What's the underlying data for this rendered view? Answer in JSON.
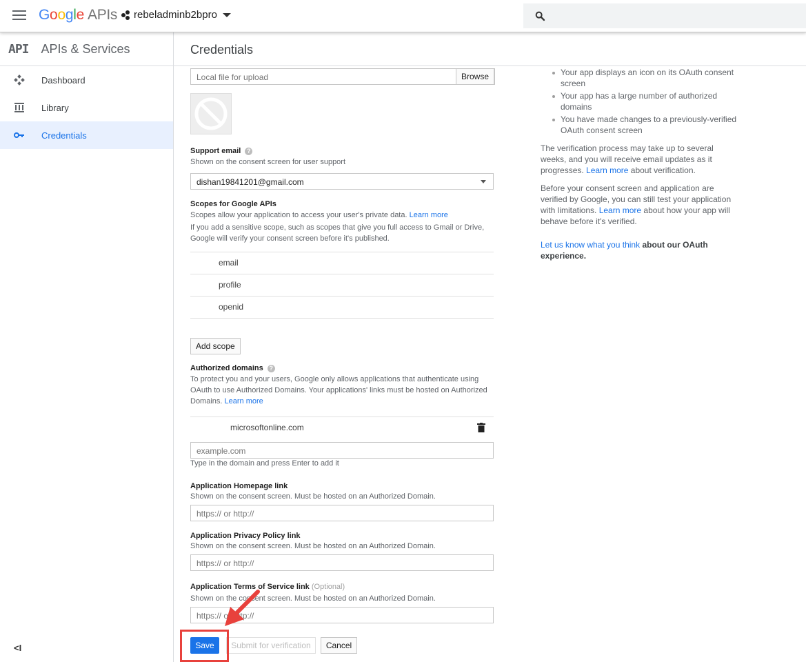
{
  "topbar": {
    "brand_google": [
      "G",
      "o",
      "o",
      "g",
      "l",
      "e"
    ],
    "brand_apis": "APIs",
    "project_name": "rebeladminb2bpro"
  },
  "leftnav": {
    "logo": "API",
    "title": "APIs & Services",
    "items": [
      {
        "label": "Dashboard",
        "icon": "dashboard-icon"
      },
      {
        "label": "Library",
        "icon": "library-icon"
      },
      {
        "label": "Credentials",
        "icon": "key-icon",
        "active": true
      }
    ]
  },
  "page": {
    "title": "Credentials"
  },
  "form": {
    "logo_file": {
      "placeholder": "Local file for upload",
      "browse_label": "Browse"
    },
    "support_email": {
      "label": "Support email",
      "help": "?",
      "description": "Shown on the consent screen for user support",
      "value": "dishan19841201@gmail.com"
    },
    "scopes": {
      "label": "Scopes for Google APIs",
      "description": "Scopes allow your application to access your user's private data.",
      "learn_more": "Learn more",
      "note": "If you add a sensitive scope, such as scopes that give you full access to Gmail or Drive, Google will verify your consent screen before it's published.",
      "items": [
        "email",
        "profile",
        "openid"
      ],
      "add_label": "Add scope"
    },
    "authorized_domains": {
      "label": "Authorized domains",
      "help": "?",
      "description": "To protect you and your users, Google only allows applications that authenticate using OAuth to use Authorized Domains. Your applications' links must be hosted on Authorized Domains.",
      "learn_more": "Learn more",
      "domains": [
        "microsoftonline.com"
      ],
      "input_placeholder": "example.com",
      "hint": "Type in the domain and press Enter to add it"
    },
    "homepage": {
      "label": "Application Homepage link",
      "description": "Shown on the consent screen. Must be hosted on an Authorized Domain.",
      "placeholder": "https:// or http://"
    },
    "privacy": {
      "label": "Application Privacy Policy link",
      "description": "Shown on the consent screen. Must be hosted on an Authorized Domain.",
      "placeholder": "https:// or http://"
    },
    "terms": {
      "label": "Application Terms of Service link",
      "optional": "(Optional)",
      "description": "Shown on the consent screen. Must be hosted on an Authorized Domain.",
      "placeholder": "https:// or http://"
    },
    "buttons": {
      "save": "Save",
      "submit": "Submit for verification",
      "cancel": "Cancel"
    }
  },
  "info": {
    "bullets": [
      "Your app displays an icon on its OAuth consent screen",
      "Your app has a large number of authorized domains",
      "You have made changes to a previously-verified OAuth consent screen"
    ],
    "p1_start": "The verification process may take up to several weeks, and you will receive email updates as it progresses.",
    "p1_link": "Learn more",
    "p1_end": "about verification.",
    "p2_start": "Before your consent screen and application are verified by Google, you can still test your application with limitations.",
    "p2_link": "Learn more",
    "p2_end": "about how your app will behave before it's verified.",
    "p3_link": "Let us know what you think",
    "p3_end": "about our OAuth experience."
  },
  "colors": {
    "accent": "#1a73e8",
    "annotation": "#e8413c"
  }
}
